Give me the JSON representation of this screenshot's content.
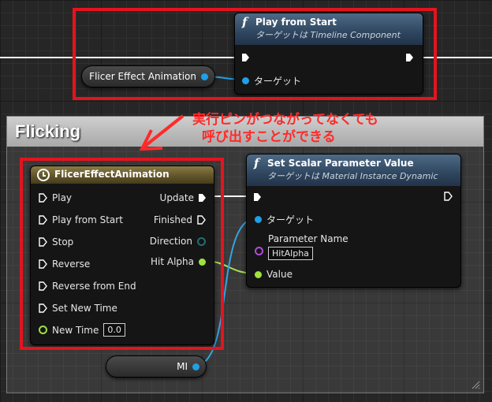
{
  "top_node": {
    "title": "Play from Start",
    "subtitle": "ターゲットは Timeline Component",
    "target_pin": "ターゲット"
  },
  "flicer_var": {
    "label": "Flicer Effect Animation"
  },
  "comment": {
    "title": "Flicking"
  },
  "annotation": {
    "line1": "実行ピンがつながってなくても",
    "line2": "呼び出すことができる",
    "color": "#ff2a2a"
  },
  "timeline_node": {
    "title": "FlicerEffectAnimation",
    "inputs": [
      "Play",
      "Play from Start",
      "Stop",
      "Reverse",
      "Reverse from End",
      "Set New Time"
    ],
    "new_time_label": "New Time",
    "new_time_value": "0.0",
    "outputs": {
      "update": "Update",
      "finished": "Finished",
      "direction": "Direction",
      "hit_alpha": "Hit Alpha"
    }
  },
  "set_node": {
    "title": "Set Scalar Parameter Value",
    "subtitle": "ターゲットは Material Instance Dynamic",
    "target_pin": "ターゲット",
    "param_name_label": "Parameter Name",
    "param_name_value": "HitAlpha",
    "value_label": "Value"
  },
  "mi_var": {
    "label": "MI"
  },
  "colors": {
    "object_pin": "#1f9fe5",
    "float_pin": "#9fe13f",
    "name_pin": "#b04cd8",
    "highlight": "#e3141e"
  },
  "icons": {
    "function": "function-icon",
    "timeline": "clock-icon"
  }
}
